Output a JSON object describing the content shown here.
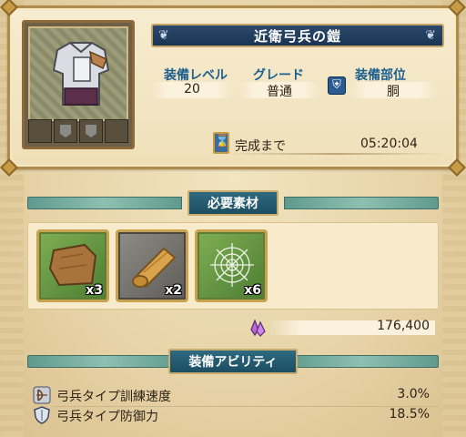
{
  "equipment": {
    "name": "近衛弓兵の鎧",
    "level_label": "装備レベル",
    "level_value": "20",
    "grade_label": "グレード",
    "grade_value": "普通",
    "slot_label": "装備部位",
    "slot_value": "胴",
    "time_label": "完成まで",
    "time_value": "05:20:04"
  },
  "materials": {
    "header": "必要素材",
    "items": [
      {
        "icon": "leather-icon",
        "qty": "x3"
      },
      {
        "icon": "cloth-roll-icon",
        "qty": "x2"
      },
      {
        "icon": "spider-web-icon",
        "qty": "x6"
      }
    ],
    "cost_icon": "crystal-icon",
    "cost_value": "176,400"
  },
  "abilities": {
    "header": "装備アビリティ",
    "items": [
      {
        "icon": "archer-icon",
        "name": "弓兵タイプ訓練速度",
        "value": "3.0%"
      },
      {
        "icon": "shield-icon",
        "name": "弓兵タイプ防御力",
        "value": "18.5%"
      }
    ]
  },
  "colors": {
    "title_banner": "#1a3452",
    "label_blue": "#1c5f8e",
    "frame_gold": "#b08a4a",
    "section_teal": "#1d4d61"
  }
}
